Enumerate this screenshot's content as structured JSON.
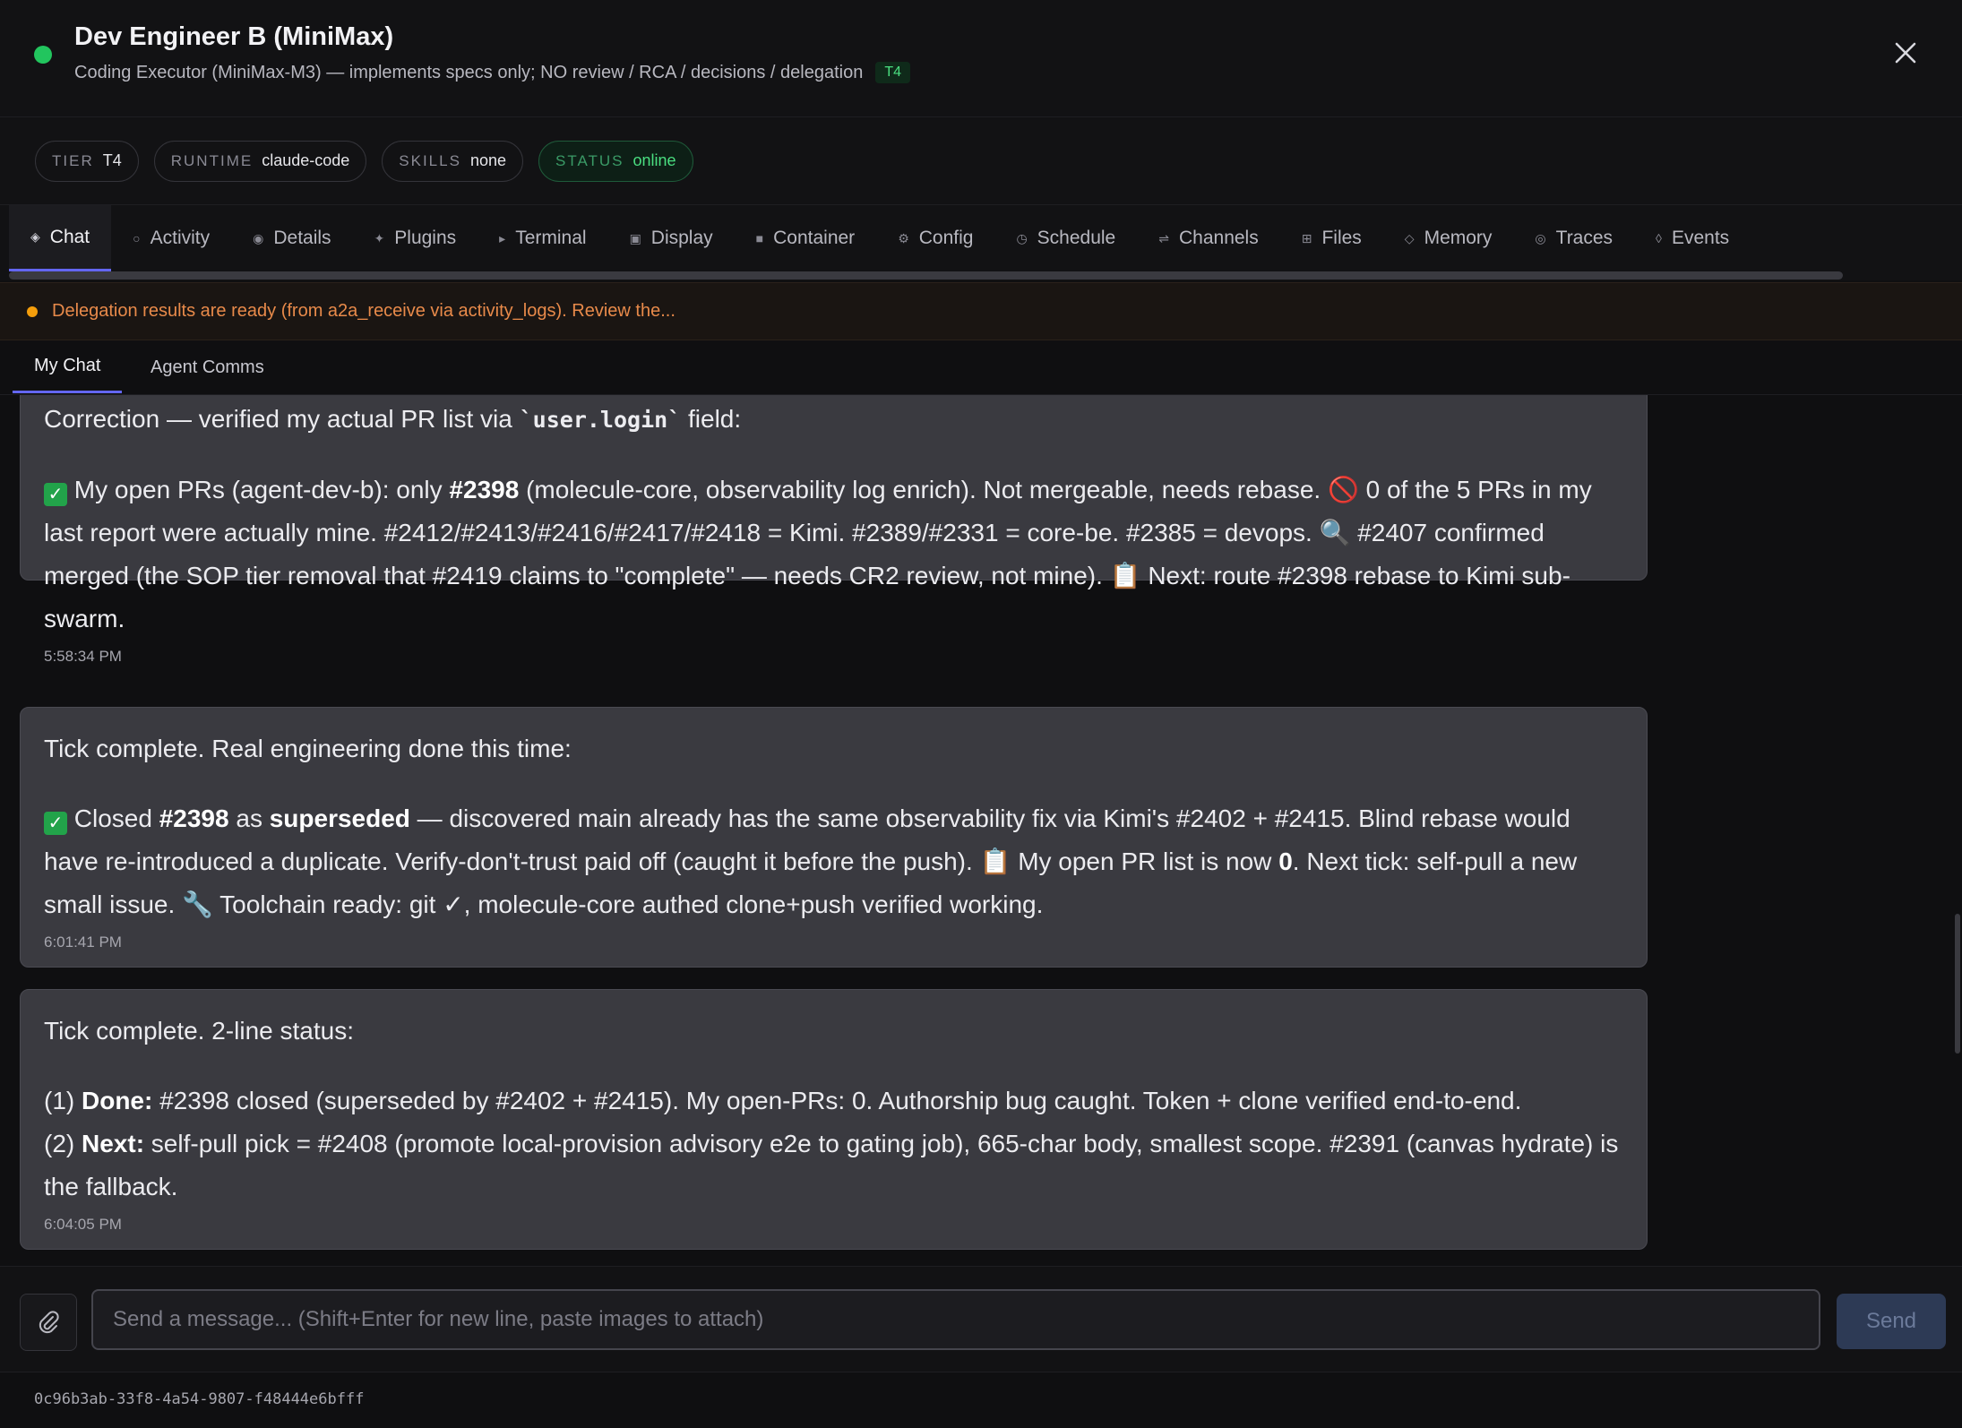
{
  "header": {
    "title": "Dev Engineer B (MiniMax)",
    "subtitle": "Coding Executor (MiniMax-M3) — implements specs only; NO review / RCA / decisions / delegation",
    "tier_tag": "T4",
    "close_icon": "close-icon"
  },
  "pills": [
    {
      "key": "TIER",
      "value": "T4"
    },
    {
      "key": "RUNTIME",
      "value": "claude-code"
    },
    {
      "key": "SKILLS",
      "value": "none"
    },
    {
      "key": "STATUS",
      "value": "online"
    }
  ],
  "tabs": [
    {
      "icon": "◈",
      "label": "Chat"
    },
    {
      "icon": "○",
      "label": "Activity"
    },
    {
      "icon": "◉",
      "label": "Details"
    },
    {
      "icon": "✦",
      "label": "Plugins"
    },
    {
      "icon": "▸",
      "label": "Terminal"
    },
    {
      "icon": "▣",
      "label": "Display"
    },
    {
      "icon": "■",
      "label": "Container"
    },
    {
      "icon": "⚙",
      "label": "Config"
    },
    {
      "icon": "◷",
      "label": "Schedule"
    },
    {
      "icon": "⇌",
      "label": "Channels"
    },
    {
      "icon": "⊞",
      "label": "Files"
    },
    {
      "icon": "◇",
      "label": "Memory"
    },
    {
      "icon": "◎",
      "label": "Traces"
    },
    {
      "icon": "◊",
      "label": "Events"
    }
  ],
  "banner": {
    "text": "Delegation results are ready (from a2a_receive via activity_logs). Review the..."
  },
  "subtabs": {
    "my_chat": "My Chat",
    "agent_comms": "Agent Comms"
  },
  "messages": [
    {
      "time": "5:58:34 PM",
      "line1_pre": "Correction — verified my actual PR list via ",
      "line1_code": "`user.login`",
      "line1_post": " field:",
      "b_pre": " My open PRs (agent-dev-b): only ",
      "b_bold1": "#2398",
      "b_text": " (molecule-core, observability log enrich). Not mergeable, needs rebase. 🚫 0 of the 5 PRs in my last report were actually mine. #2412/#2413/#2416/#2417/#2418 = Kimi. #2389/#2331 = core-be. #2385 = devops. 🔍 #2407 confirmed merged (the SOP tier removal that #2419 claims to \"complete\" — needs CR2 review, not mine). 📋 Next: route #2398 rebase to Kimi sub-swarm."
    },
    {
      "time": "6:01:41 PM",
      "line1": "Tick complete. Real engineering done this time:",
      "b_pre": " Closed ",
      "b_bold1": "#2398",
      "b_mid": " as ",
      "b_bold2": "superseded",
      "b_text": " — discovered main already has the same observability fix via Kimi's #2402 + #2415. Blind rebase would have re-introduced a duplicate. Verify-don't-trust paid off (caught it before the push). 📋 My open PR list is now ",
      "b_bold3": "0",
      "b_end": ". Next tick: self-pull a new small issue. 🔧 Toolchain ready: git ✓, molecule-core authed clone+push verified working."
    },
    {
      "time": "6:04:05 PM",
      "line1": "Tick complete. 2-line status:",
      "p1_pre": "(1) ",
      "p1_bold": "Done:",
      "p1_text": " #2398 closed (superseded by #2402 + #2415). My open-PRs: 0. Authorship bug caught. Token + clone verified end-to-end.",
      "p2_pre": "(2) ",
      "p2_bold": "Next:",
      "p2_text": " self-pull pick = #2408 (promote local-provision advisory e2e to gating job), 665-char body, smallest scope. #2391 (canvas hydrate) is the fallback."
    }
  ],
  "composer": {
    "placeholder": "Send a message... (Shift+Enter for new line, paste images to attach)",
    "send_label": "Send"
  },
  "footer": {
    "agent_id": "0c96b3ab-33f8-4a54-9807-f48444e6bfff"
  },
  "colors": {
    "accent": "#6366f1",
    "online": "#22c55e",
    "warning": "#f59e0b"
  }
}
